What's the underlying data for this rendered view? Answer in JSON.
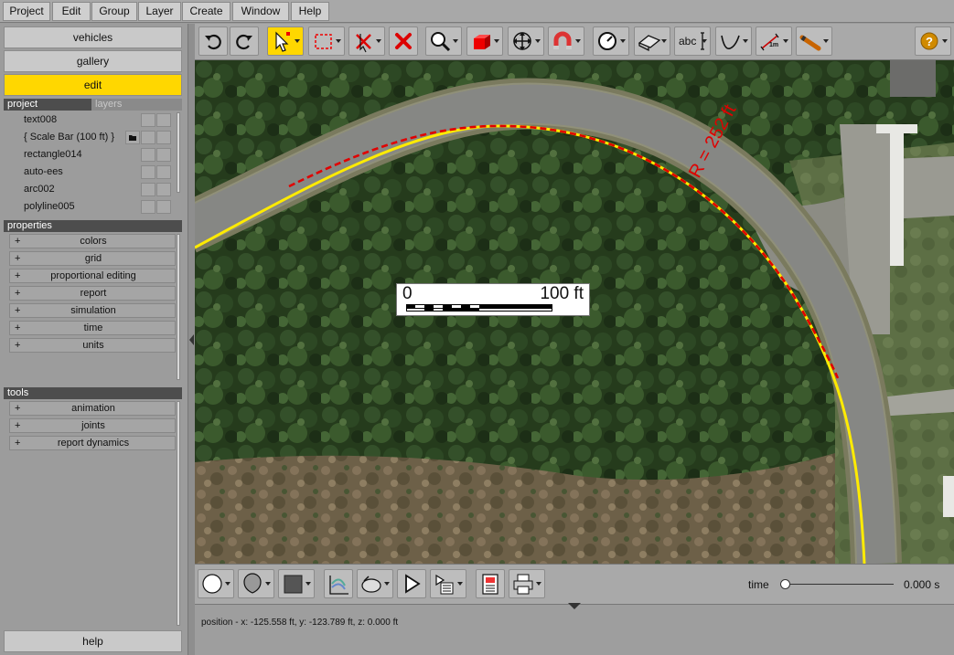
{
  "menubar": {
    "items": [
      "Project",
      "Edit",
      "Group",
      "Layer",
      "Create",
      "Window",
      "Help"
    ]
  },
  "sidebar": {
    "vehicles_label": "vehicles",
    "gallery_label": "gallery",
    "edit_label": "edit",
    "help_label": "help",
    "project_tab": "project",
    "layers_tab": "layers",
    "project_items": [
      "text008",
      "{ Scale Bar (100 ft) }",
      "rectangle014",
      "auto-ees",
      "arc002",
      "polyline005"
    ],
    "properties_header": "properties",
    "properties": [
      "colors",
      "grid",
      "proportional editing",
      "report",
      "simulation",
      "time",
      "units"
    ],
    "tools_header": "tools",
    "tools": [
      "animation",
      "joints",
      "report dynamics"
    ],
    "plus": "+"
  },
  "toolbar": {
    "text_tool_label": "abc",
    "measure_label": "1m",
    "icons": [
      "undo-icon",
      "redo-icon",
      "select-arrow-icon",
      "rectangle-select-icon",
      "delete-selected-icon",
      "delete-icon",
      "zoom-icon",
      "3d-box-icon",
      "move-icon",
      "magnet-icon",
      "dial-icon",
      "surface-icon",
      "text-tool-icon",
      "curve-icon",
      "measure-icon",
      "ruler-pencil-icon",
      "help-icon"
    ]
  },
  "viewport": {
    "scale_start": "0",
    "scale_end": "100 ft",
    "radius_label": "R = 252 ft",
    "colors": {
      "path_yellow": "#ffeb00",
      "path_red": "#e00000"
    }
  },
  "bottom_toolbar": {
    "time_label": "time",
    "time_value": "0.000 s",
    "time_slider_fraction": 0.0
  },
  "status": {
    "position": "position - x: -125.558 ft, y: -123.789 ft, z: 0.000 ft"
  }
}
